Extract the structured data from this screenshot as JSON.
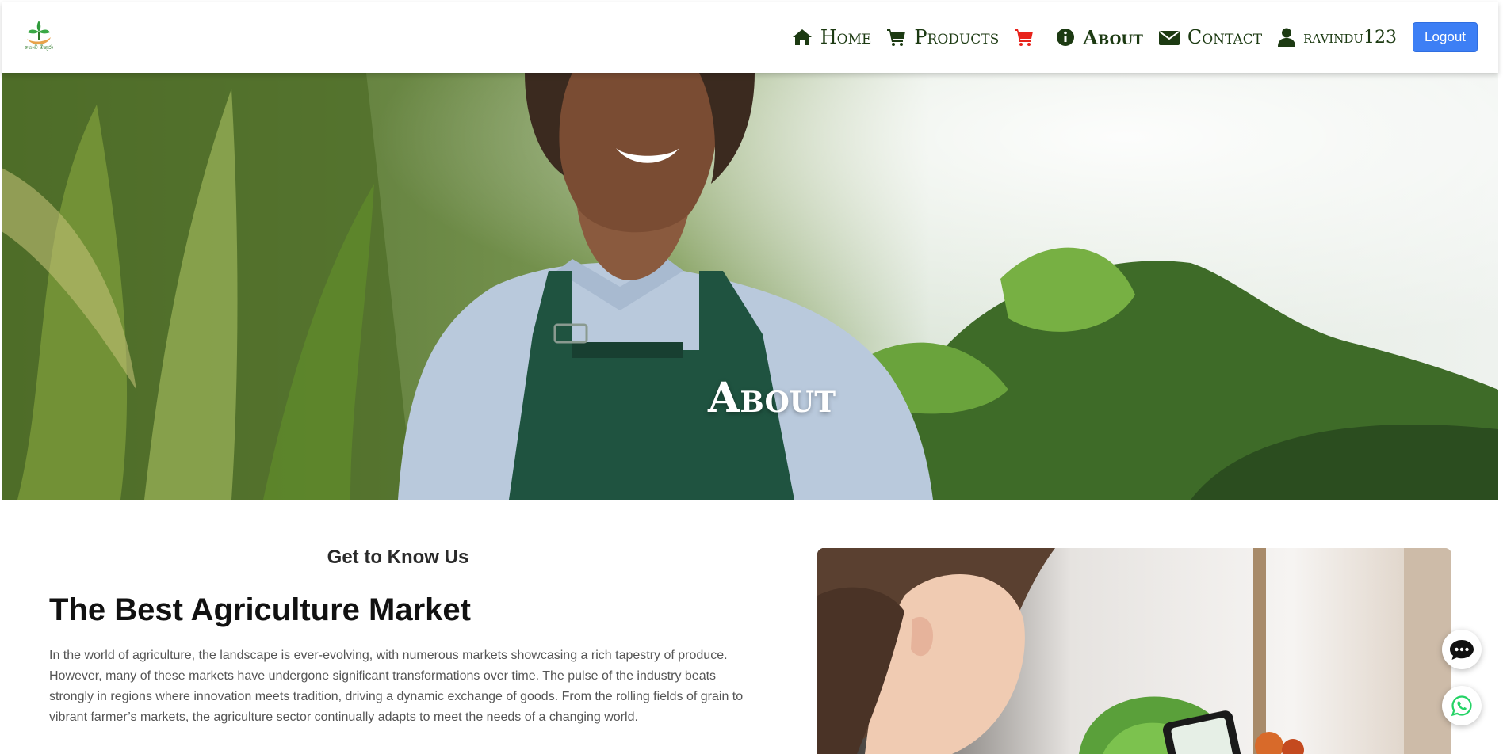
{
  "navbar": {
    "logo_icon": "agri-logo-icon",
    "logo_text": "ගොවි මිතුරා",
    "items": [
      {
        "label": "Home",
        "icon": "home-icon"
      },
      {
        "label": "Products",
        "icon": "cart-icon"
      },
      {
        "label": "",
        "icon": "cart-red-icon"
      },
      {
        "label": "About",
        "icon": "info-icon"
      },
      {
        "label": "Contact",
        "icon": "envelope-icon"
      },
      {
        "label": "ravindu123",
        "icon": "user-icon"
      }
    ],
    "logout_label": "Logout",
    "active": "About"
  },
  "hero": {
    "title": "About",
    "image": "farmer-smiling-in-field-photo"
  },
  "intro": {
    "subheading": "Get to Know Us",
    "heading": "The Best Agriculture Market",
    "paragraph": "In the world of agriculture, the landscape is ever-evolving, with numerous markets showcasing a rich tapestry of produce. However, many of these markets have undergone significant transformations over time. The pulse of the industry beats strongly in regions where innovation meets tradition, driving a dynamic exchange of goods. From the rolling fields of grain to vibrant farmer’s markets, the agriculture sector continually adapts to meet the needs of a changing world."
  },
  "side_image": "woman-with-phone-and-vegetables-photo",
  "floating": {
    "chat_icon": "chat-bubble-icon",
    "whatsapp_icon": "whatsapp-icon"
  },
  "colors": {
    "nav_text": "#1c3a12",
    "cart_red": "#e8231c",
    "logout_bg": "#3d7ff5",
    "whatsapp_green": "#25d366"
  }
}
